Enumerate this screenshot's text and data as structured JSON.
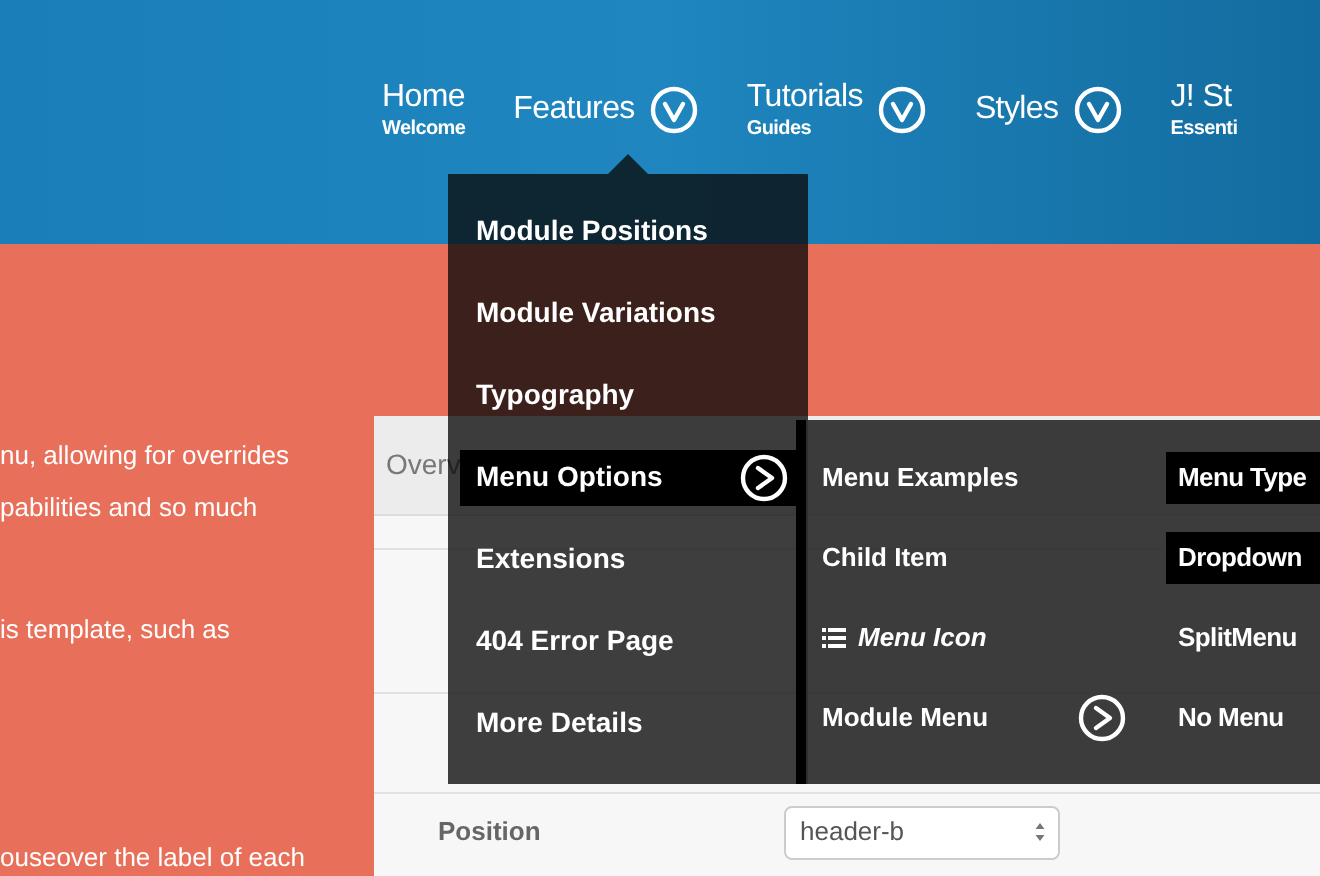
{
  "nav": [
    {
      "label": "Home",
      "sublabel": "Welcome",
      "has_submenu": false
    },
    {
      "label": "Features",
      "has_submenu": true
    },
    {
      "label": "Tutorials",
      "sublabel": "Guides",
      "has_submenu": true
    },
    {
      "label": "Styles",
      "has_submenu": true
    },
    {
      "label": "J! St",
      "sublabel": "Essenti",
      "has_submenu": false
    }
  ],
  "intro_lines": [
    "nu, allowing for overrides",
    "pabilities and so much",
    "is template, such as",
    "ouseover the label of each"
  ],
  "panel": {
    "tab": "Overv",
    "rows": [
      {
        "label": "Position",
        "value": "header-b"
      }
    ]
  },
  "dropdown": {
    "items": [
      {
        "label": "Module Positions",
        "selected": false,
        "has_submenu": false
      },
      {
        "label": "Module Variations",
        "selected": false,
        "has_submenu": false
      },
      {
        "label": "Typography",
        "selected": false,
        "has_submenu": false
      },
      {
        "label": "Menu Options",
        "selected": true,
        "has_submenu": true
      },
      {
        "label": "Extensions",
        "selected": false,
        "has_submenu": false
      },
      {
        "label": "404 Error Page",
        "selected": false,
        "has_submenu": false
      },
      {
        "label": "More Details",
        "selected": false,
        "has_submenu": false
      }
    ]
  },
  "submenu": {
    "items": [
      {
        "label": "Menu Examples",
        "kind": "text",
        "has_submenu": false
      },
      {
        "label": "Child Item",
        "kind": "text",
        "has_submenu": false
      },
      {
        "label": "Menu Icon",
        "kind": "icon",
        "has_submenu": false
      },
      {
        "label": "Module Menu",
        "kind": "text",
        "has_submenu": true
      }
    ],
    "side_items": [
      {
        "label": "Menu Type",
        "selected": true
      },
      {
        "label": "Dropdown",
        "selected": true
      },
      {
        "label": "SplitMenu",
        "selected": false
      },
      {
        "label": "No Menu",
        "selected": false
      }
    ]
  }
}
